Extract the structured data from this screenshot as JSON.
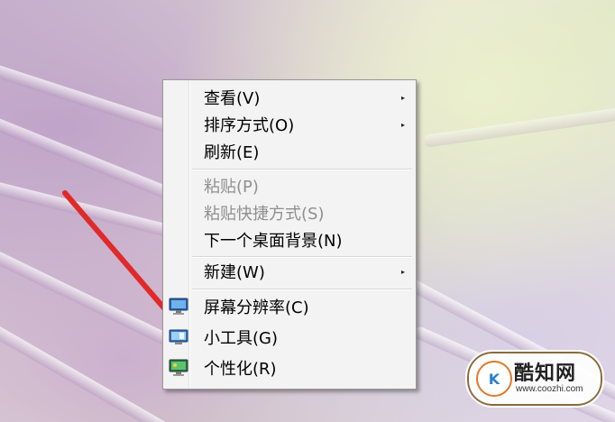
{
  "context_menu": {
    "items": [
      {
        "label": "查看(V)",
        "has_submenu": true,
        "enabled": true
      },
      {
        "label": "排序方式(O)",
        "has_submenu": true,
        "enabled": true
      },
      {
        "label": "刷新(E)",
        "has_submenu": false,
        "enabled": true
      },
      {
        "label": "粘贴(P)",
        "has_submenu": false,
        "enabled": false
      },
      {
        "label": "粘贴快捷方式(S)",
        "has_submenu": false,
        "enabled": false
      },
      {
        "label": "下一个桌面背景(N)",
        "has_submenu": false,
        "enabled": true
      },
      {
        "label": "新建(W)",
        "has_submenu": true,
        "enabled": true
      },
      {
        "label": "屏幕分辨率(C)",
        "has_submenu": false,
        "enabled": true,
        "icon": "screen-resolution-icon"
      },
      {
        "label": "小工具(G)",
        "has_submenu": false,
        "enabled": true,
        "icon": "gadgets-icon"
      },
      {
        "label": "个性化(R)",
        "has_submenu": false,
        "enabled": true,
        "icon": "personalize-icon"
      }
    ],
    "submenu_glyph": "▸"
  },
  "watermark": {
    "logo_text": "K",
    "title": "酷知网",
    "url": "www.coozhi.com"
  },
  "colors": {
    "arrow": "#e02a2a",
    "menu_bg": "#f3f3f3",
    "disabled_text": "#8f8f8f"
  }
}
